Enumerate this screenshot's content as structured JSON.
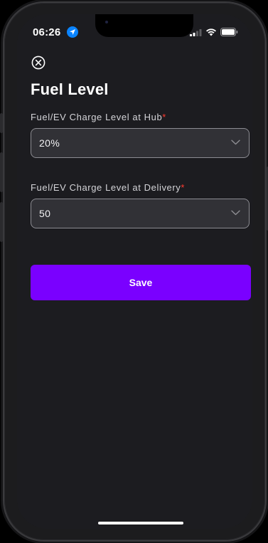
{
  "status_bar": {
    "time": "06:26"
  },
  "header": {
    "close_icon": "close-circle-icon",
    "title": "Fuel Level"
  },
  "form": {
    "hub_field": {
      "label": "Fuel/EV Charge Level at Hub",
      "required_mark": "*",
      "value": "20%"
    },
    "delivery_field": {
      "label": "Fuel/EV Charge Level at Delivery",
      "required_mark": "*",
      "value": "50"
    },
    "save_label": "Save"
  },
  "colors": {
    "accent": "#7a00ff",
    "required": "#ff3b30",
    "background": "#1c1c20",
    "field_background": "#313136"
  }
}
